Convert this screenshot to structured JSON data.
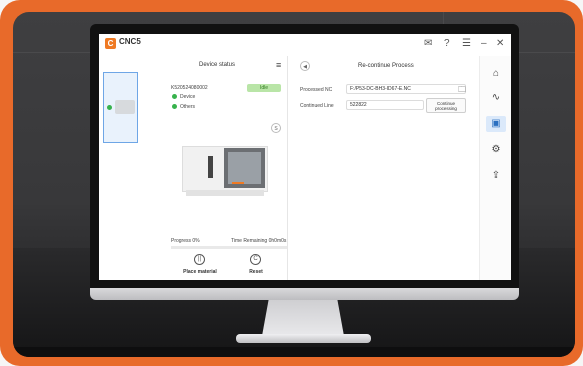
{
  "app": {
    "logo_text": "CNC5",
    "logo_subtext": "",
    "logo_glyph": "C"
  },
  "titlebar": {
    "icons": [
      "message-icon",
      "help-icon",
      "menu-icon",
      "minimize-icon",
      "close-icon"
    ],
    "glyphs": {
      "message": "✉",
      "help": "?",
      "menu": "☰",
      "minimize": "–",
      "close": "✕"
    }
  },
  "device_panel": {
    "title": "Device status",
    "menu_glyph": "≡",
    "device_id": "K520524080002",
    "status_badge": "Idle",
    "status_rows": [
      "Device",
      "Others"
    ],
    "status_color": "#37b24d",
    "info_button": "S",
    "progress_label": "Progress 0%",
    "progress_value": 0,
    "time_remaining": "Time Remaining 0h0m0s",
    "buttons": [
      {
        "label": "Place material",
        "icon": "place-material-icon",
        "glyph": "||"
      },
      {
        "label": "Reset",
        "icon": "reset-icon",
        "glyph": "C"
      }
    ]
  },
  "process_panel": {
    "back_glyph": "◀",
    "title": "Re-continue Process",
    "processed_nc_label": "Processed NC",
    "processed_nc_value": "F:/P53-DC-BH3-ID67-E.NC",
    "folder_glyph": "🗀",
    "continued_line_label": "Continued Line",
    "continued_line_value": "522822",
    "continue_button": "Continue processing"
  },
  "sidebar": {
    "items": [
      {
        "name": "home-icon",
        "glyph": "⌂",
        "active": false
      },
      {
        "name": "waveform-icon",
        "glyph": "∿",
        "active": false
      },
      {
        "name": "re-continue-icon",
        "glyph": "▣",
        "active": true
      },
      {
        "name": "settings-icon",
        "glyph": "⚙",
        "active": false
      },
      {
        "name": "upload-icon",
        "glyph": "⇪",
        "active": false
      }
    ]
  },
  "colors": {
    "accent": "#ef7a24",
    "frame": "#e86a2a",
    "active": "#2a6fc0"
  }
}
